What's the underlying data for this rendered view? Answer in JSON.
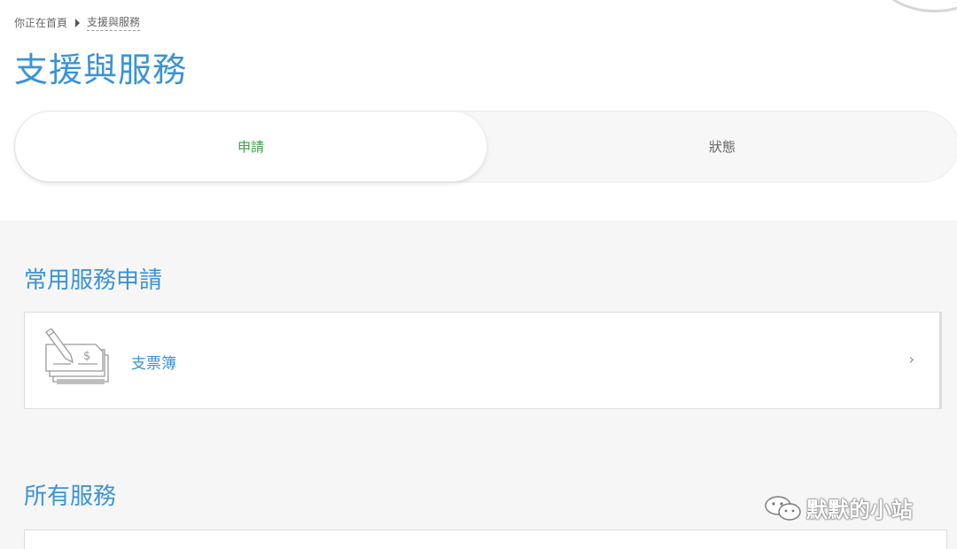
{
  "breadcrumb": {
    "home": "你正在首頁",
    "current": "支援與服務"
  },
  "page_title": "支援與服務",
  "tabs": [
    {
      "label": "申請",
      "active": true
    },
    {
      "label": "狀態",
      "active": false
    }
  ],
  "sections": {
    "common": {
      "title": "常用服務申請",
      "items": [
        {
          "label": "支票簿",
          "icon": "cheque-book-icon"
        }
      ]
    },
    "all": {
      "title": "所有服務"
    }
  },
  "watermark": {
    "text": "默默的小站",
    "icon": "wechat-icon"
  },
  "colors": {
    "accent_blue": "#3a93d8",
    "active_tab_green": "#3aa04a"
  }
}
